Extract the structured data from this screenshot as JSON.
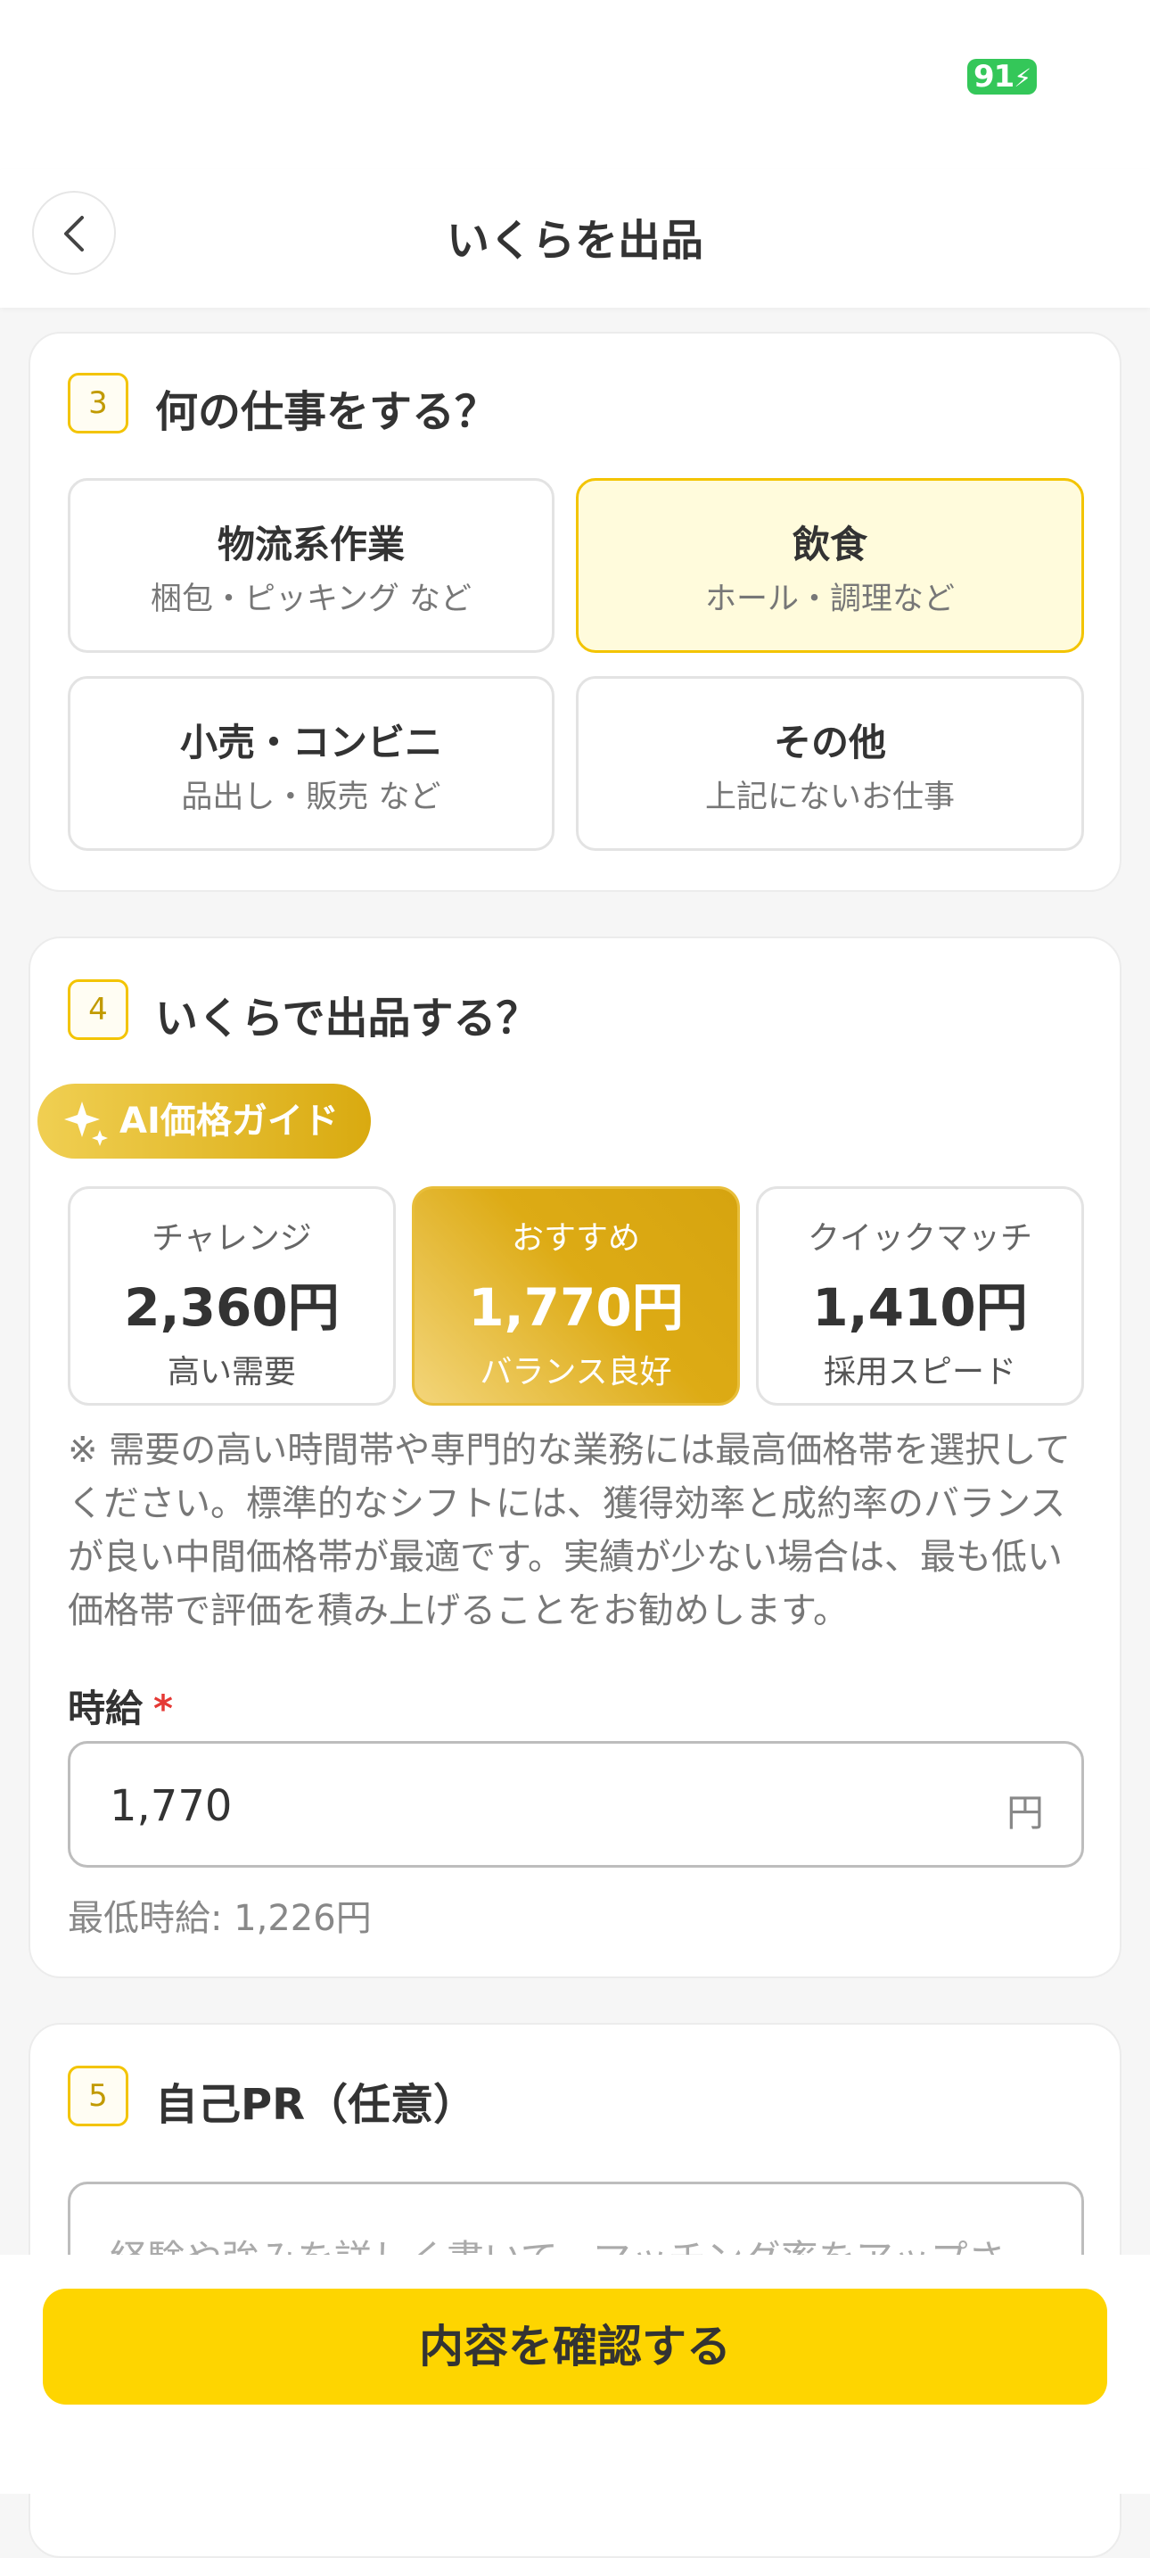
{
  "status_bar": {
    "battery": "91"
  },
  "header": {
    "title": "いくらを出品"
  },
  "step3": {
    "number": "3",
    "title": "何の仕事をする？",
    "options": [
      {
        "title": "物流系作業",
        "subtitle": "梱包・ピッキング など",
        "selected": false
      },
      {
        "title": "飲食",
        "subtitle": "ホール・調理など",
        "selected": true
      },
      {
        "title": "小売・コンビニ",
        "subtitle": "品出し・販売 など",
        "selected": false
      },
      {
        "title": "その他",
        "subtitle": "上記にないお仕事",
        "selected": false
      }
    ]
  },
  "step4": {
    "number": "4",
    "title": "いくらで出品する？",
    "ai_badge": "AI価格ガイド",
    "prices": [
      {
        "label": "チャレンジ",
        "amount": "2,360円",
        "note": "高い需要",
        "recommended": false
      },
      {
        "label": "おすすめ",
        "amount": "1,770円",
        "note": "バランス良好",
        "recommended": true
      },
      {
        "label": "クイックマッチ",
        "amount": "1,410円",
        "note": "採用スピード",
        "recommended": false
      }
    ],
    "note": "※ 需要の高い時間帯や専門的な業務には最高価格帯を選択してください。標準的なシフトには、獲得効率と成約率のバランスが良い中間価格帯が最適です。実績が少ない場合は、最も低い価格帯で評価を積み上げることをお勧めします。",
    "field_label": "時給",
    "required_mark": "*",
    "rate_value": "1,770",
    "rate_unit": "円",
    "min_rate": "最低時給: 1,226円"
  },
  "step5": {
    "number": "5",
    "title": "自己PR（任意）",
    "placeholder": "経験や強みを詳しく書いて、マッチング率をアップさ"
  },
  "footer": {
    "confirm_label": "内容を確認する"
  },
  "colors": {
    "accent": "#fed500",
    "selected_bg": "#fffbdc",
    "required": "#e53935"
  }
}
